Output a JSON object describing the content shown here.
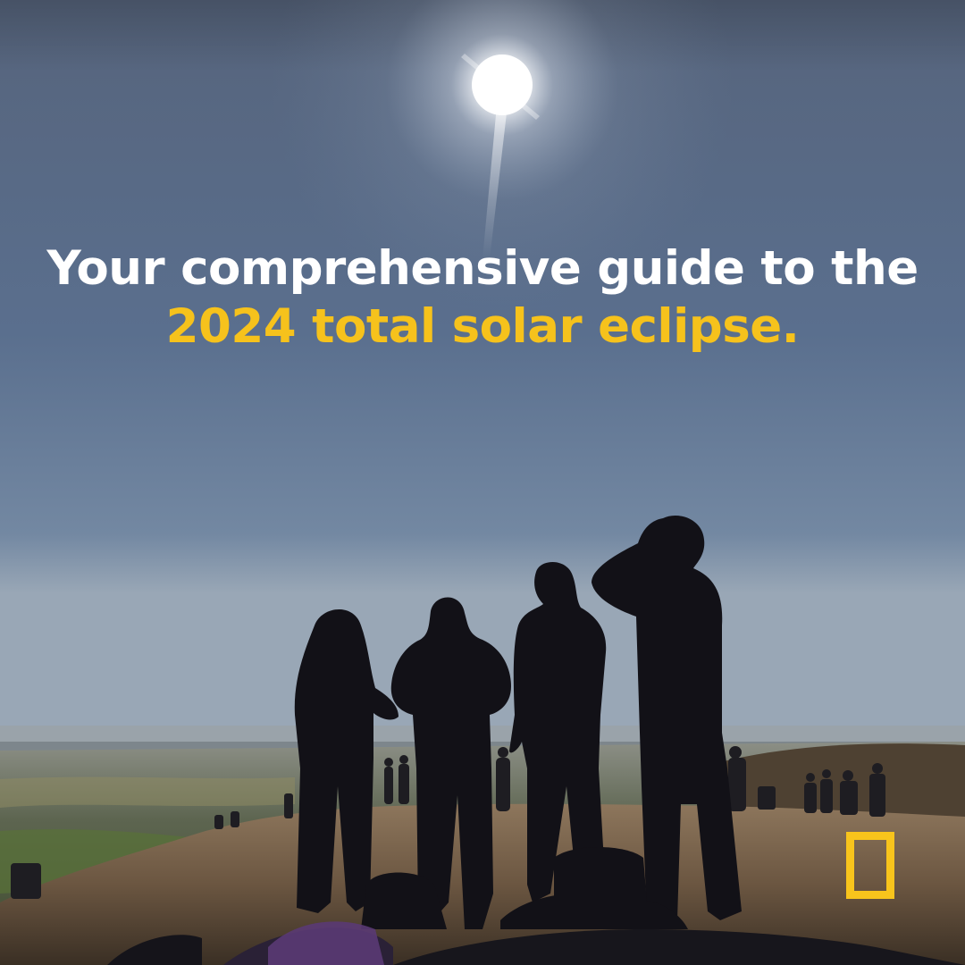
{
  "photo": {
    "subject": "Four people silhouetted on a hilltop looking up at the sun, with onlookers and a valley behind them"
  },
  "headline": {
    "line1": "Your comprehensive guide to the",
    "line2": "2024 total solar eclipse."
  },
  "logo": {
    "icon": "yellow-rectangle-frame-icon"
  },
  "colors": {
    "headline_text": "#ffffff",
    "highlight_text": "#f6c21c",
    "logo_border": "#f8c41c"
  }
}
